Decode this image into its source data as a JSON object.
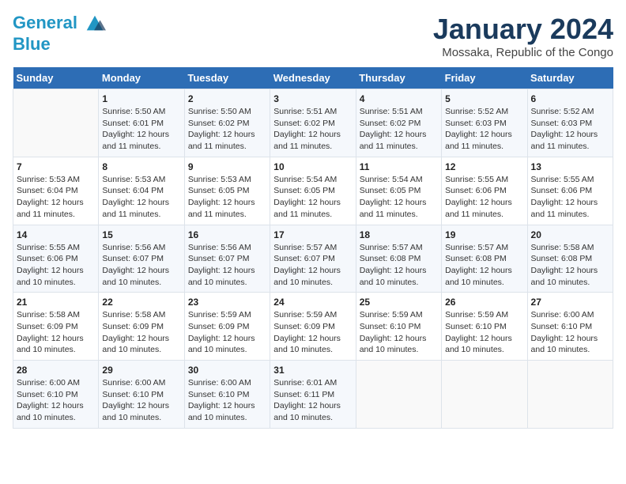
{
  "header": {
    "logo_line1": "General",
    "logo_line2": "Blue",
    "month_year": "January 2024",
    "location": "Mossaka, Republic of the Congo"
  },
  "weekdays": [
    "Sunday",
    "Monday",
    "Tuesday",
    "Wednesday",
    "Thursday",
    "Friday",
    "Saturday"
  ],
  "weeks": [
    [
      {
        "day": "",
        "info": ""
      },
      {
        "day": "1",
        "info": "Sunrise: 5:50 AM\nSunset: 6:01 PM\nDaylight: 12 hours\nand 11 minutes."
      },
      {
        "day": "2",
        "info": "Sunrise: 5:50 AM\nSunset: 6:02 PM\nDaylight: 12 hours\nand 11 minutes."
      },
      {
        "day": "3",
        "info": "Sunrise: 5:51 AM\nSunset: 6:02 PM\nDaylight: 12 hours\nand 11 minutes."
      },
      {
        "day": "4",
        "info": "Sunrise: 5:51 AM\nSunset: 6:02 PM\nDaylight: 12 hours\nand 11 minutes."
      },
      {
        "day": "5",
        "info": "Sunrise: 5:52 AM\nSunset: 6:03 PM\nDaylight: 12 hours\nand 11 minutes."
      },
      {
        "day": "6",
        "info": "Sunrise: 5:52 AM\nSunset: 6:03 PM\nDaylight: 12 hours\nand 11 minutes."
      }
    ],
    [
      {
        "day": "7",
        "info": "Sunrise: 5:53 AM\nSunset: 6:04 PM\nDaylight: 12 hours\nand 11 minutes."
      },
      {
        "day": "8",
        "info": "Sunrise: 5:53 AM\nSunset: 6:04 PM\nDaylight: 12 hours\nand 11 minutes."
      },
      {
        "day": "9",
        "info": "Sunrise: 5:53 AM\nSunset: 6:05 PM\nDaylight: 12 hours\nand 11 minutes."
      },
      {
        "day": "10",
        "info": "Sunrise: 5:54 AM\nSunset: 6:05 PM\nDaylight: 12 hours\nand 11 minutes."
      },
      {
        "day": "11",
        "info": "Sunrise: 5:54 AM\nSunset: 6:05 PM\nDaylight: 12 hours\nand 11 minutes."
      },
      {
        "day": "12",
        "info": "Sunrise: 5:55 AM\nSunset: 6:06 PM\nDaylight: 12 hours\nand 11 minutes."
      },
      {
        "day": "13",
        "info": "Sunrise: 5:55 AM\nSunset: 6:06 PM\nDaylight: 12 hours\nand 11 minutes."
      }
    ],
    [
      {
        "day": "14",
        "info": "Sunrise: 5:55 AM\nSunset: 6:06 PM\nDaylight: 12 hours\nand 10 minutes."
      },
      {
        "day": "15",
        "info": "Sunrise: 5:56 AM\nSunset: 6:07 PM\nDaylight: 12 hours\nand 10 minutes."
      },
      {
        "day": "16",
        "info": "Sunrise: 5:56 AM\nSunset: 6:07 PM\nDaylight: 12 hours\nand 10 minutes."
      },
      {
        "day": "17",
        "info": "Sunrise: 5:57 AM\nSunset: 6:07 PM\nDaylight: 12 hours\nand 10 minutes."
      },
      {
        "day": "18",
        "info": "Sunrise: 5:57 AM\nSunset: 6:08 PM\nDaylight: 12 hours\nand 10 minutes."
      },
      {
        "day": "19",
        "info": "Sunrise: 5:57 AM\nSunset: 6:08 PM\nDaylight: 12 hours\nand 10 minutes."
      },
      {
        "day": "20",
        "info": "Sunrise: 5:58 AM\nSunset: 6:08 PM\nDaylight: 12 hours\nand 10 minutes."
      }
    ],
    [
      {
        "day": "21",
        "info": "Sunrise: 5:58 AM\nSunset: 6:09 PM\nDaylight: 12 hours\nand 10 minutes."
      },
      {
        "day": "22",
        "info": "Sunrise: 5:58 AM\nSunset: 6:09 PM\nDaylight: 12 hours\nand 10 minutes."
      },
      {
        "day": "23",
        "info": "Sunrise: 5:59 AM\nSunset: 6:09 PM\nDaylight: 12 hours\nand 10 minutes."
      },
      {
        "day": "24",
        "info": "Sunrise: 5:59 AM\nSunset: 6:09 PM\nDaylight: 12 hours\nand 10 minutes."
      },
      {
        "day": "25",
        "info": "Sunrise: 5:59 AM\nSunset: 6:10 PM\nDaylight: 12 hours\nand 10 minutes."
      },
      {
        "day": "26",
        "info": "Sunrise: 5:59 AM\nSunset: 6:10 PM\nDaylight: 12 hours\nand 10 minutes."
      },
      {
        "day": "27",
        "info": "Sunrise: 6:00 AM\nSunset: 6:10 PM\nDaylight: 12 hours\nand 10 minutes."
      }
    ],
    [
      {
        "day": "28",
        "info": "Sunrise: 6:00 AM\nSunset: 6:10 PM\nDaylight: 12 hours\nand 10 minutes."
      },
      {
        "day": "29",
        "info": "Sunrise: 6:00 AM\nSunset: 6:10 PM\nDaylight: 12 hours\nand 10 minutes."
      },
      {
        "day": "30",
        "info": "Sunrise: 6:00 AM\nSunset: 6:10 PM\nDaylight: 12 hours\nand 10 minutes."
      },
      {
        "day": "31",
        "info": "Sunrise: 6:01 AM\nSunset: 6:11 PM\nDaylight: 12 hours\nand 10 minutes."
      },
      {
        "day": "",
        "info": ""
      },
      {
        "day": "",
        "info": ""
      },
      {
        "day": "",
        "info": ""
      }
    ]
  ]
}
